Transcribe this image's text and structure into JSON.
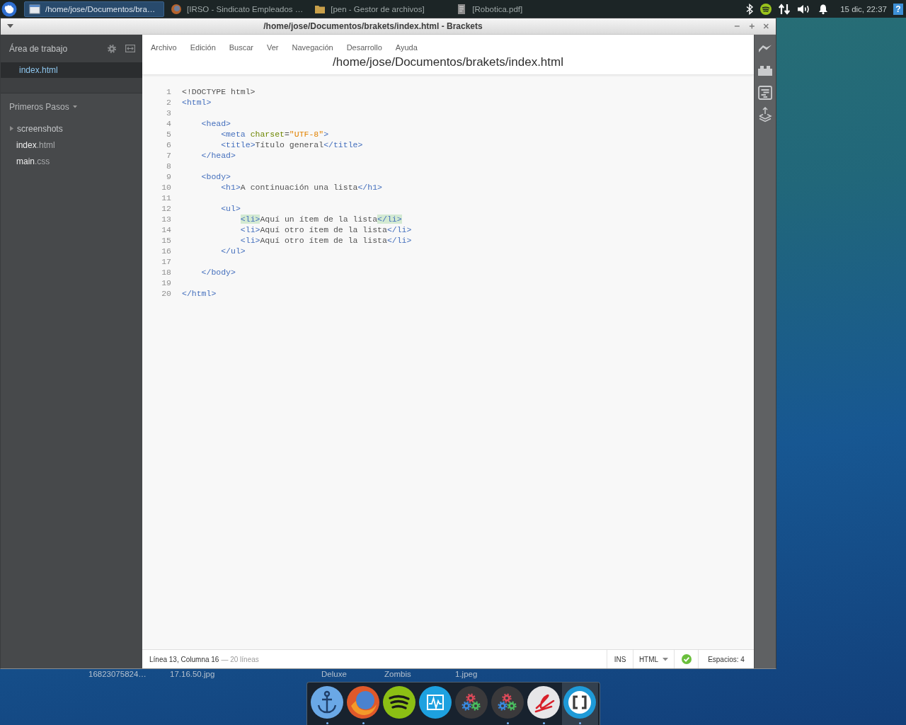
{
  "top_panel": {
    "tasks": [
      {
        "label": "/home/jose/Documentos/bra…",
        "kind": "window",
        "selected": true
      },
      {
        "label": "[IRSO - Sindicato Empleados …",
        "kind": "browser",
        "selected": false
      },
      {
        "label": "[pen - Gestor de archivos]",
        "kind": "folder",
        "selected": false
      },
      {
        "label": "[Robotica.pdf]",
        "kind": "document",
        "selected": false
      }
    ],
    "clock": "15 dic, 22:37",
    "help_glyph": "?"
  },
  "window": {
    "title": "/home/jose/Documentos/brakets/index.html - Brackets"
  },
  "sidebar": {
    "working_set_title": "Área de trabajo",
    "working_set": [
      {
        "label": "index.html",
        "selected": true
      }
    ],
    "project_title": "Primeros Pasos",
    "tree": [
      {
        "kind": "folder",
        "name": "screenshots",
        "expanded": false
      },
      {
        "kind": "file",
        "name": "index",
        "ext": ".html"
      },
      {
        "kind": "file",
        "name": "main",
        "ext": ".css"
      }
    ]
  },
  "menu": [
    "Archivo",
    "Edición",
    "Buscar",
    "Ver",
    "Navegación",
    "Desarrollo",
    "Ayuda"
  ],
  "editor": {
    "file_path": "/home/jose/Documentos/brakets/index.html",
    "lines": [
      {
        "number": "1",
        "tokens": [
          {
            "kind": "doctype",
            "text": "<!DOCTYPE html>"
          }
        ]
      },
      {
        "number": "2",
        "tokens": [
          {
            "kind": "tag",
            "text": "<html>"
          }
        ]
      },
      {
        "number": "3"
      },
      {
        "number": "4",
        "tokens": [
          {
            "kind": "tag",
            "text": "    <head>"
          }
        ]
      },
      {
        "number": "5",
        "tokens": [
          {
            "kind": "tag",
            "text": "        <meta "
          },
          {
            "kind": "attr",
            "text": "charset"
          },
          {
            "kind": "text",
            "text": "="
          },
          {
            "kind": "string",
            "text": "\"UTF-8\""
          },
          {
            "kind": "tag",
            "text": ">"
          }
        ]
      },
      {
        "number": "6",
        "tokens": [
          {
            "kind": "tag",
            "text": "        <title>"
          },
          {
            "kind": "text",
            "text": "Título general"
          },
          {
            "kind": "tag",
            "text": "</title>"
          }
        ]
      },
      {
        "number": "7",
        "tokens": [
          {
            "kind": "tag",
            "text": "    </head>"
          }
        ]
      },
      {
        "number": "8"
      },
      {
        "number": "9",
        "tokens": [
          {
            "kind": "tag",
            "text": "    <body>"
          }
        ]
      },
      {
        "number": "10",
        "tokens": [
          {
            "kind": "tag",
            "text": "        <h1>"
          },
          {
            "kind": "text",
            "text": "A continuación una lista"
          },
          {
            "kind": "tag",
            "text": "</h1>"
          }
        ]
      },
      {
        "number": "11"
      },
      {
        "number": "12",
        "tokens": [
          {
            "kind": "tag",
            "text": "        <ul>"
          }
        ]
      },
      {
        "number": "13",
        "tokens": [
          {
            "kind": "tag_match",
            "text": "            <li>"
          },
          {
            "kind": "text",
            "text": "Aquí un ítem de la lista"
          },
          {
            "kind": "tag_match",
            "text": "</li>"
          }
        ]
      },
      {
        "number": "14",
        "tokens": [
          {
            "kind": "tag",
            "text": "            <li>"
          },
          {
            "kind": "text",
            "text": "Aquí otro ítem de la lista"
          },
          {
            "kind": "tag",
            "text": "</li>"
          }
        ]
      },
      {
        "number": "15",
        "tokens": [
          {
            "kind": "tag",
            "text": "            <li>"
          },
          {
            "kind": "text",
            "text": "Aquí otro ítem de la lista"
          },
          {
            "kind": "tag",
            "text": "</li>"
          }
        ]
      },
      {
        "number": "16",
        "tokens": [
          {
            "kind": "tag",
            "text": "        </ul>"
          }
        ]
      },
      {
        "number": "17"
      },
      {
        "number": "18",
        "tokens": [
          {
            "kind": "tag",
            "text": "    </body>"
          }
        ]
      },
      {
        "number": "19"
      },
      {
        "number": "20",
        "tokens": [
          {
            "kind": "tag",
            "text": "</html>"
          }
        ]
      }
    ]
  },
  "status_bar": {
    "cursor": "Línea 13, Columna 16",
    "line_count": "— 20 líneas",
    "mode": "INS",
    "language": "HTML",
    "indentation": "Espacios: 4"
  },
  "desktop_labels": [
    "16823075824…",
    "17.16.50.jpg",
    "Deluxe",
    "Zombis",
    "1.jpeg"
  ],
  "dock": [
    {
      "kind": "anchor",
      "running": true,
      "active": false
    },
    {
      "kind": "browser",
      "running": true,
      "active": false
    },
    {
      "kind": "music",
      "running": false,
      "active": false
    },
    {
      "kind": "monitor",
      "running": false,
      "active": false
    },
    {
      "kind": "gears",
      "running": false,
      "active": false
    },
    {
      "kind": "gears",
      "running": true,
      "active": false
    },
    {
      "kind": "signature",
      "running": true,
      "active": false
    },
    {
      "kind": "editor",
      "running": true,
      "active": true
    }
  ]
}
